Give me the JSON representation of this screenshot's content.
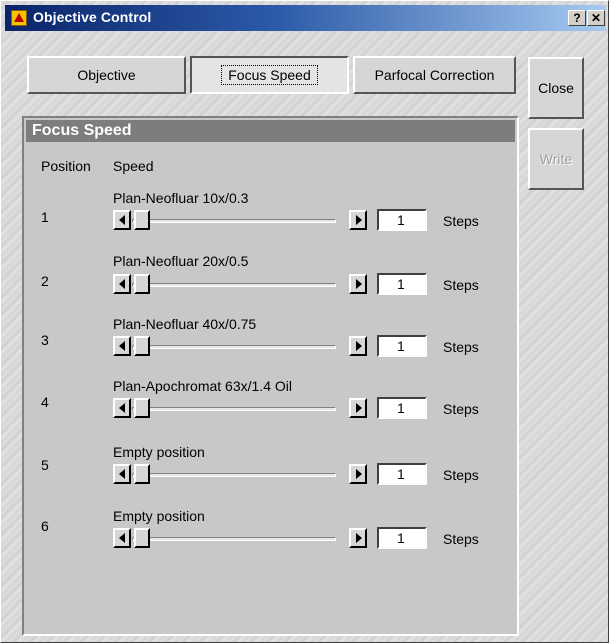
{
  "window": {
    "title": "Objective Control",
    "help_label": "?",
    "close_label": "✕"
  },
  "tabs": [
    {
      "label": "Objective"
    },
    {
      "label": "Focus Speed",
      "active": true
    },
    {
      "label": "Parfocal Correction"
    }
  ],
  "side_buttons": {
    "close_label": "Close",
    "write_label": "Write"
  },
  "panel": {
    "title": "Focus Speed",
    "col_position": "Position",
    "col_speed": "Speed",
    "rows": [
      {
        "position": "1",
        "objective": "Plan-Neofluar 10x/0.3",
        "steps": "1",
        "unit": "Steps"
      },
      {
        "position": "2",
        "objective": "Plan-Neofluar 20x/0.5",
        "steps": "1",
        "unit": "Steps"
      },
      {
        "position": "3",
        "objective": "Plan-Neofluar 40x/0.75",
        "steps": "1",
        "unit": "Steps"
      },
      {
        "position": "4",
        "objective": "Plan-Apochromat 63x/1.4 Oil",
        "steps": "1",
        "unit": "Steps"
      },
      {
        "position": "5",
        "objective": "Empty position",
        "steps": "1",
        "unit": "Steps"
      },
      {
        "position": "6",
        "objective": "Empty position",
        "steps": "1",
        "unit": "Steps"
      }
    ]
  },
  "icons": {
    "app_icon": "microscope-app-icon",
    "scroll_left": "arrow-left-icon",
    "scroll_right": "arrow-right-icon"
  }
}
